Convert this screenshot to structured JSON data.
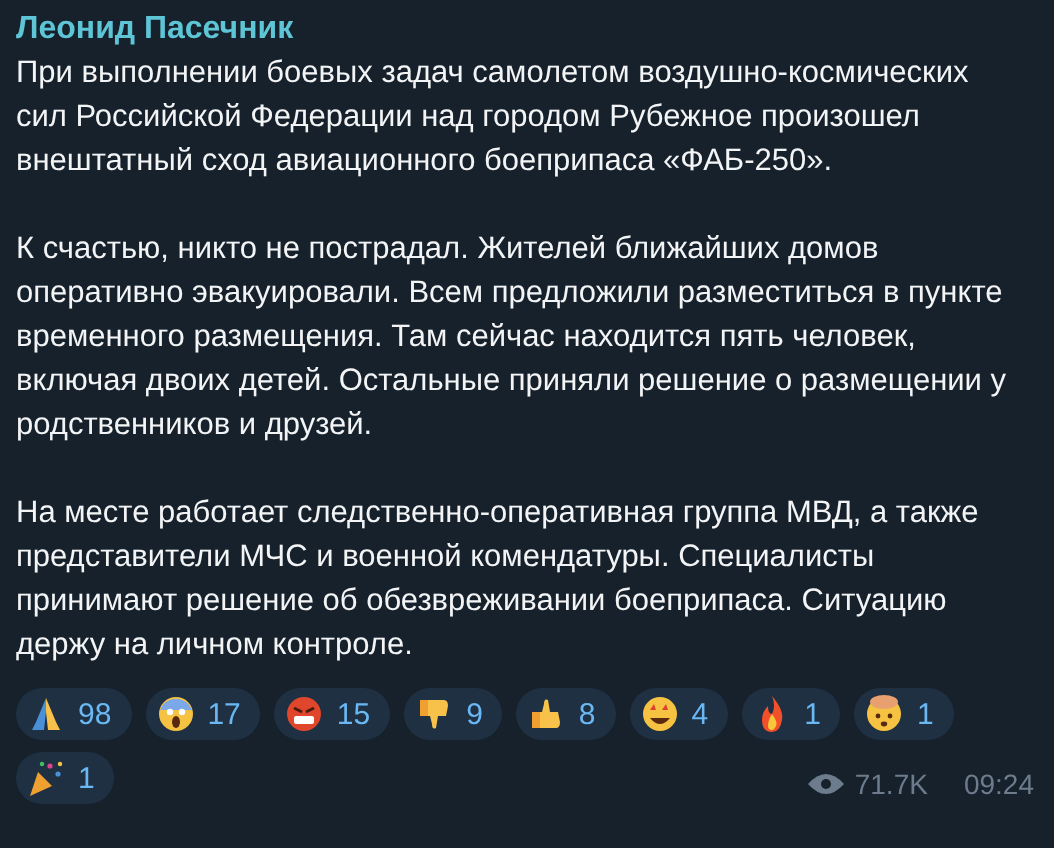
{
  "message": {
    "author": "Леонид Пасечник",
    "paragraphs": [
      "При выполнении боевых задач самолетом воздушно-космических сил Российской Федерации над городом Рубежное произошел внештатный сход авиационного боеприпаса «ФАБ-250».",
      "К счастью, никто не пострадал. Жителей ближайших домов оперативно эвакуировали. Всем предложили разместиться в пункте временного размещения. Там сейчас находится пять человек, включая двоих детей. Остальные приняли решение о размещении у родственников и друзей.",
      "На месте работает следственно-оперативная группа МВД, а также представители МЧС и военной комендатуры. Специалисты принимают решение об обезвреживании боеприпаса. Ситуацию держу на личном контроле."
    ],
    "reactions": [
      {
        "kind": "pray",
        "count": "98"
      },
      {
        "kind": "scream",
        "count": "17"
      },
      {
        "kind": "angry",
        "count": "15"
      },
      {
        "kind": "thumbsdown",
        "count": "9"
      },
      {
        "kind": "thumbsup",
        "count": "8"
      },
      {
        "kind": "stareyes",
        "count": "4"
      },
      {
        "kind": "fire",
        "count": "1"
      },
      {
        "kind": "explode",
        "count": "1"
      },
      {
        "kind": "party",
        "count": "1"
      }
    ],
    "views": "71.7K",
    "time": "09:24"
  }
}
